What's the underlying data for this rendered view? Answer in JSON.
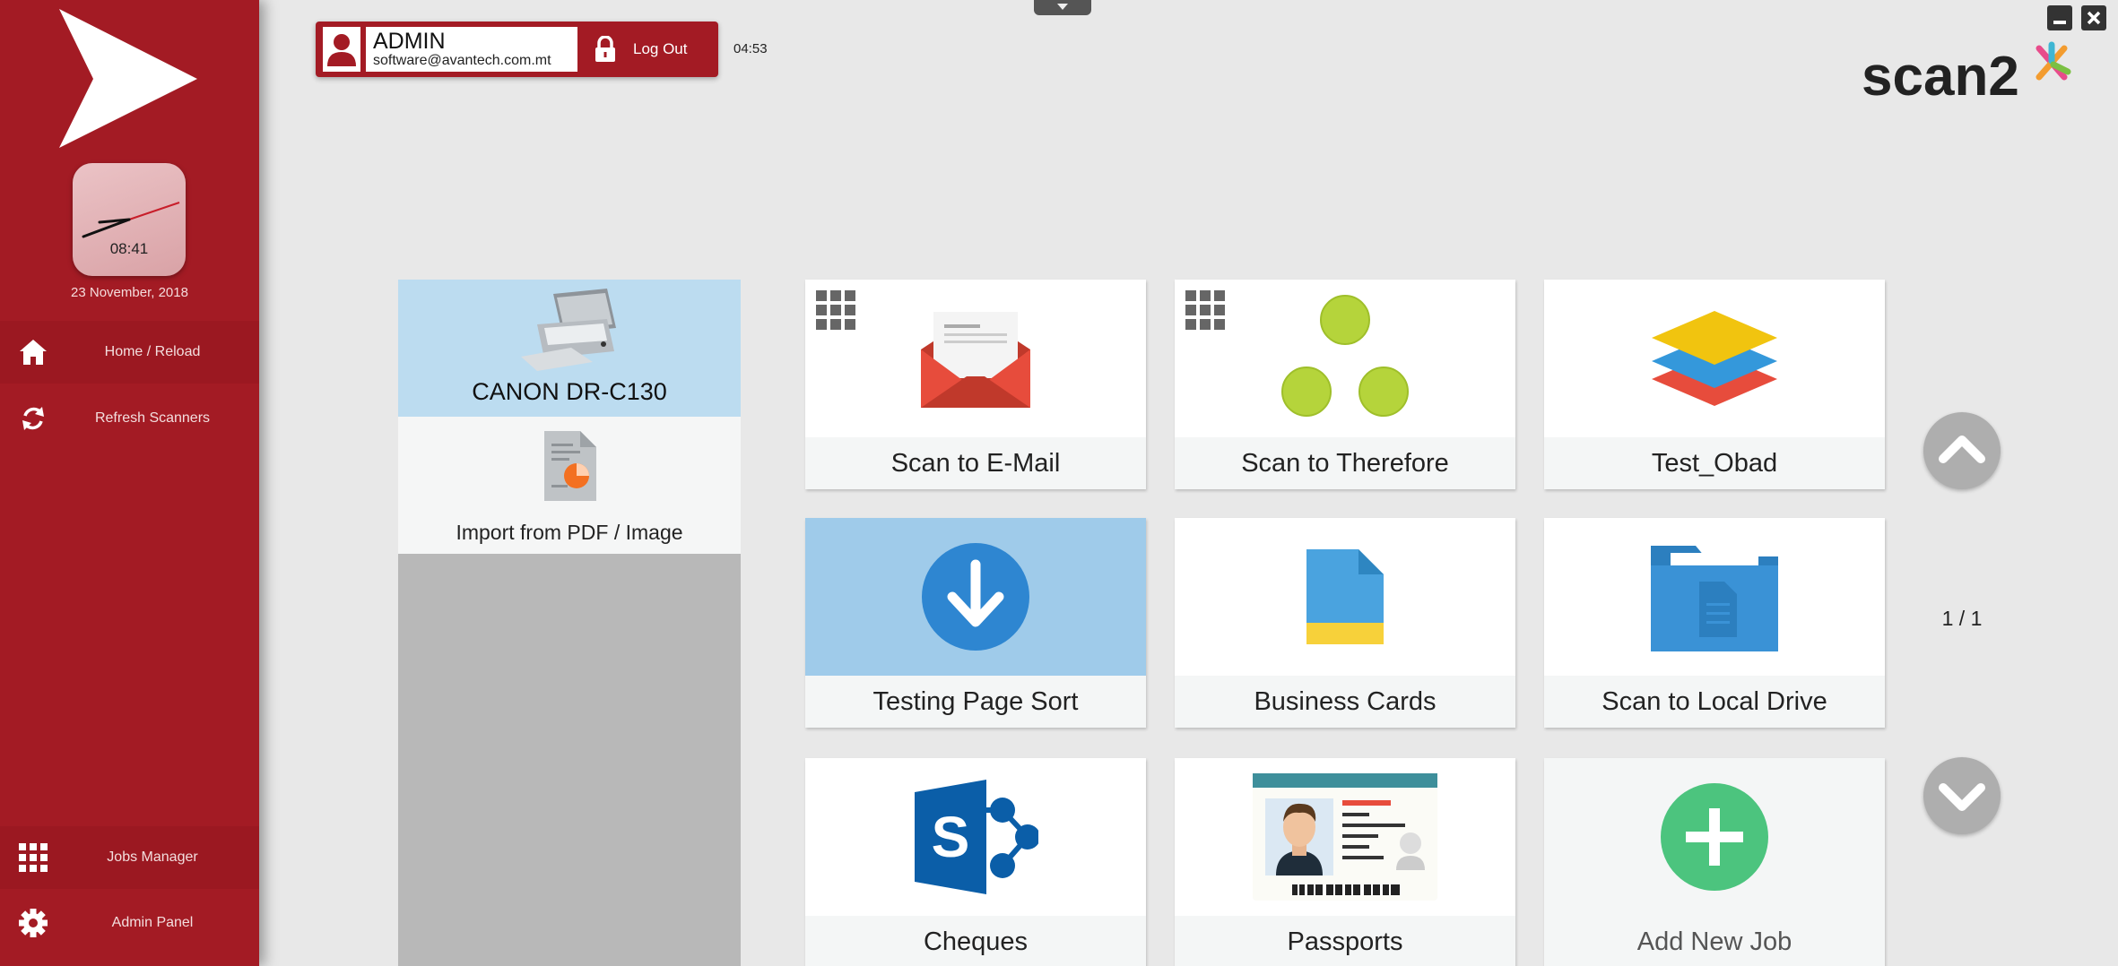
{
  "sidebar": {
    "clock_time": "08:41",
    "date": "23 November, 2018",
    "items": [
      {
        "label": "Home / Reload",
        "icon": "home-icon"
      },
      {
        "label": "Refresh Scanners",
        "icon": "refresh-icon"
      },
      {
        "label": "Jobs Manager",
        "icon": "grid-icon"
      },
      {
        "label": "Admin Panel",
        "icon": "gear-icon"
      }
    ]
  },
  "user": {
    "name": "ADMIN",
    "email": "software@avantech.com.mt",
    "logout_label": "Log Out",
    "session_timer": "04:53"
  },
  "brand": {
    "name": "scan2x"
  },
  "scanners": {
    "selected": "CANON DR-C130",
    "import_label": "Import from PDF / Image"
  },
  "jobs": [
    {
      "label": "Scan to E-Mail",
      "icon": "envelope-icon"
    },
    {
      "label": "Scan to Therefore",
      "icon": "therefore-icon"
    },
    {
      "label": "Test_Obad",
      "icon": "layers-icon"
    },
    {
      "label": "Testing Page Sort",
      "icon": "download-arrow-icon"
    },
    {
      "label": "Business Cards",
      "icon": "document-icon"
    },
    {
      "label": "Scan to Local Drive",
      "icon": "folder-icon"
    },
    {
      "label": "Cheques",
      "icon": "sharepoint-icon"
    },
    {
      "label": "Passports",
      "icon": "id-card-icon"
    },
    {
      "label": "Add New Job",
      "icon": "plus-icon"
    }
  ],
  "pagination": {
    "page_label": "1 / 1"
  },
  "colors": {
    "accent": "#a31b24",
    "selected_tile": "#9fcbea",
    "scanner_selected": "#bcdcf0",
    "add_green": "#4cc47e"
  }
}
